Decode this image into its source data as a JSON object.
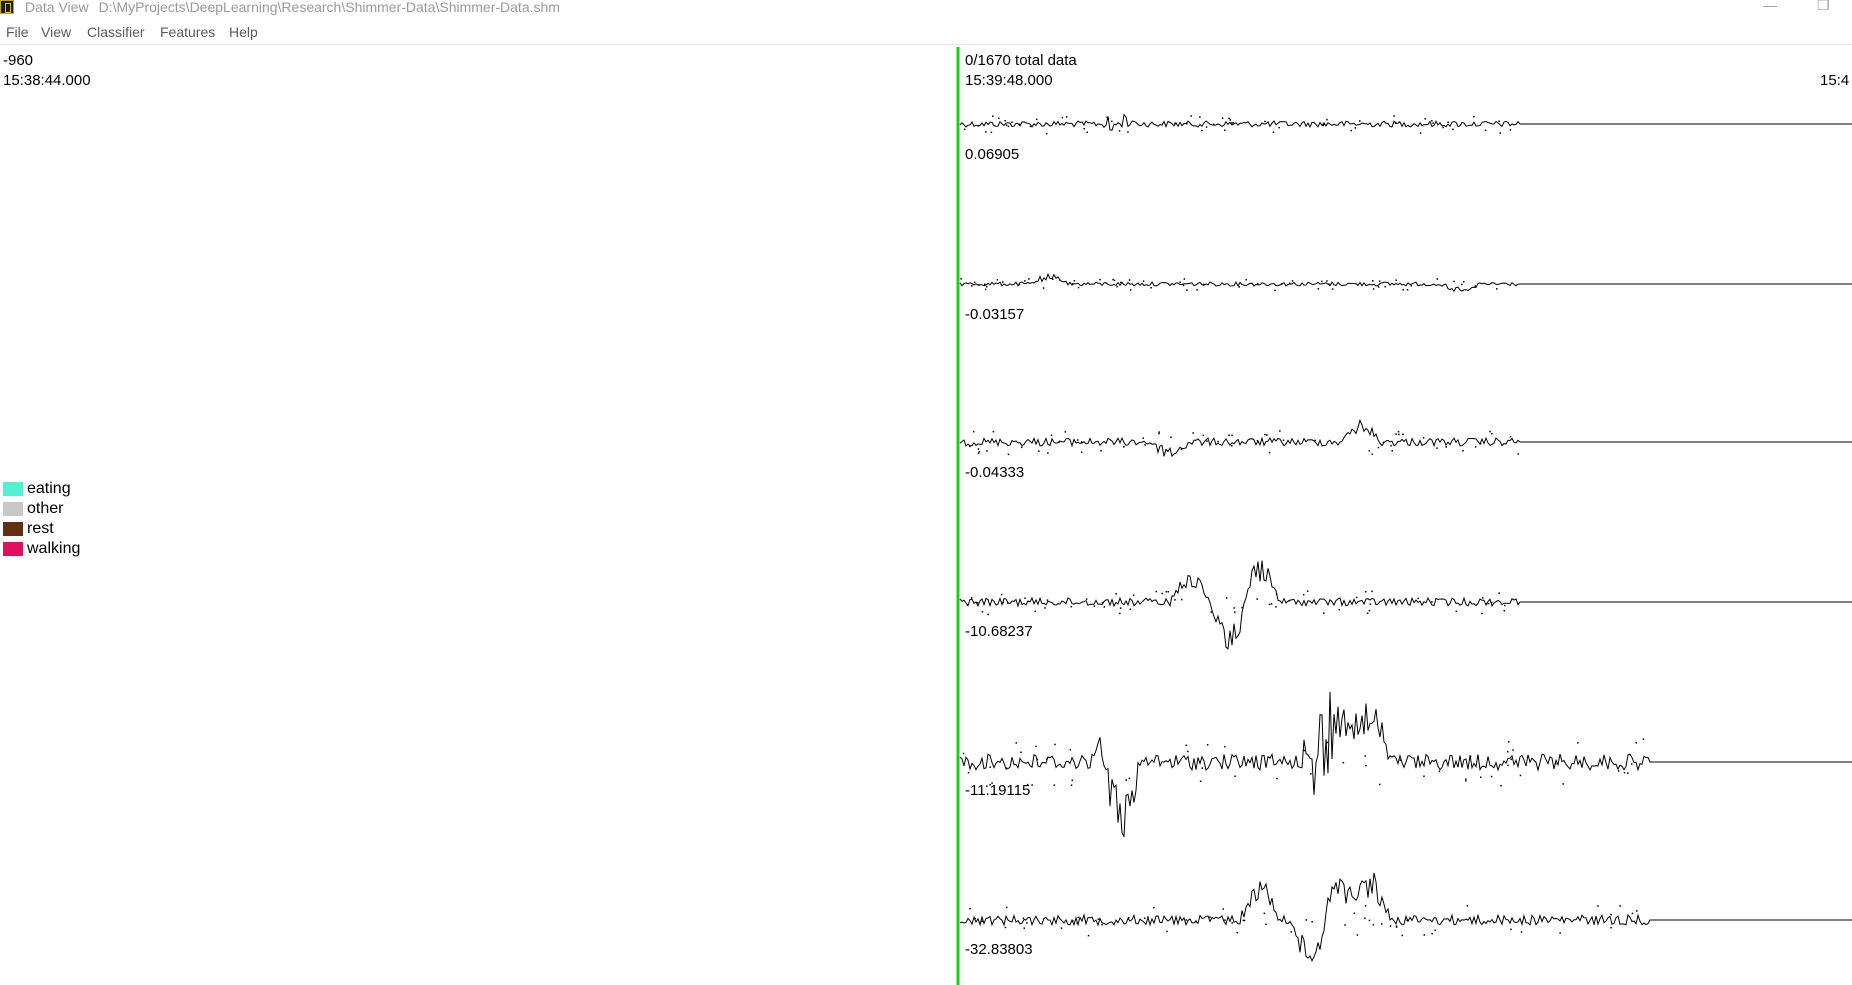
{
  "window": {
    "title": "Data View",
    "path": "D:\\MyProjects\\DeepLearning\\Research\\Shimmer-Data\\Shimmer-Data.shm",
    "minimize_glyph": "—",
    "restore_glyph": "❐"
  },
  "menu": [
    "File",
    "View",
    "Classifier",
    "Features",
    "Help"
  ],
  "left_readout": {
    "value": "-960",
    "time": "15:38:44.000"
  },
  "cursor_readout": {
    "count": "0/1670 total data",
    "time": "15:39:48.000"
  },
  "right_time_partial": "15:4",
  "legend": [
    {
      "label": "eating",
      "color": "#55f0d0"
    },
    {
      "label": "other",
      "color": "#c8c8c8"
    },
    {
      "label": "rest",
      "color": "#603010"
    },
    {
      "label": "walking",
      "color": "#e0105e"
    }
  ],
  "cursor_color": "#22cc22",
  "chart_data": {
    "type": "line",
    "channels": [
      {
        "value_label": "0.06905",
        "noise": 3,
        "spikes": [
          [
            160,
            -20
          ],
          [
            160,
            20
          ],
          [
            520,
            0
          ]
        ]
      },
      {
        "value_label": "-0.03157",
        "noise": 2,
        "spikes": [
          [
            90,
            -8
          ],
          [
            500,
            8
          ]
        ]
      },
      {
        "value_label": "-0.04333",
        "noise": 4,
        "spikes": [
          [
            400,
            -18
          ],
          [
            210,
            12
          ]
        ]
      },
      {
        "value_label": "-10.68237",
        "noise": 4,
        "spikes": [
          [
            270,
            45
          ],
          [
            300,
            -40
          ],
          [
            230,
            -30
          ]
        ]
      },
      {
        "value_label": "-11.19115",
        "noise": 8,
        "spikes": [
          [
            150,
            -40
          ],
          [
            160,
            90
          ],
          [
            360,
            -100
          ],
          [
            360,
            90
          ],
          [
            380,
            -50
          ],
          [
            410,
            -60
          ]
        ]
      },
      {
        "value_label": "-32.83803",
        "noise": 5,
        "spikes": [
          [
            350,
            40
          ],
          [
            410,
            -45
          ],
          [
            380,
            -40
          ],
          [
            300,
            -35
          ]
        ]
      }
    ]
  }
}
